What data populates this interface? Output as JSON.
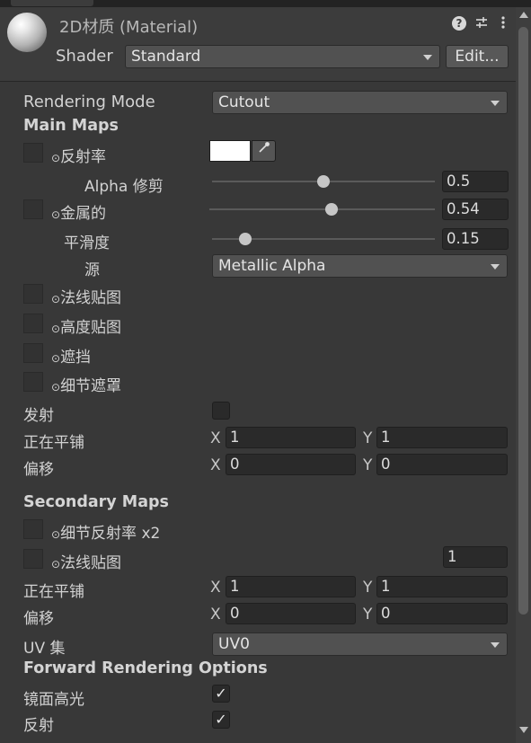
{
  "header": {
    "title": "2D材质 (Material)",
    "shader_label": "Shader",
    "shader_value": "Standard",
    "edit_button": "Edit...",
    "icons": [
      "help-icon",
      "preset-sliders-icon",
      "kebab-menu-icon"
    ]
  },
  "rendering_mode": {
    "label": "Rendering Mode",
    "value": "Cutout"
  },
  "main_maps": {
    "heading": "Main Maps",
    "albedo_label": "反射率",
    "albedo_color": "#ffffff",
    "alpha_cutoff": {
      "label": "Alpha 修剪",
      "value": "0.5",
      "fraction": 0.5
    },
    "metallic": {
      "label": "金属的",
      "value": "0.54",
      "fraction": 0.54
    },
    "smoothness": {
      "label": "平滑度",
      "value": "0.15",
      "fraction": 0.15
    },
    "source": {
      "label": "源",
      "value": "Metallic Alpha"
    },
    "normal_map_label": "法线贴图",
    "height_map_label": "高度贴图",
    "occlusion_label": "遮挡",
    "detail_mask_label": "细节遮罩",
    "emission_label": "发射",
    "emission_checked": false,
    "tiling": {
      "label": "正在平铺",
      "x_label": "X",
      "x": "1",
      "y_label": "Y",
      "y": "1"
    },
    "offset": {
      "label": "偏移",
      "x_label": "X",
      "x": "0",
      "y_label": "Y",
      "y": "0"
    }
  },
  "secondary_maps": {
    "heading": "Secondary Maps",
    "detail_albedo_label": "细节反射率 x2",
    "normal_map_label": "法线贴图",
    "normal_scale": "1",
    "tiling": {
      "label": "正在平铺",
      "x_label": "X",
      "x": "1",
      "y_label": "Y",
      "y": "1"
    },
    "offset": {
      "label": "偏移",
      "x_label": "X",
      "x": "0",
      "y_label": "Y",
      "y": "0"
    },
    "uv_set": {
      "label": "UV 集",
      "value": "UV0"
    }
  },
  "forward_rendering": {
    "heading": "Forward Rendering Options",
    "specular_label": "镜面高光",
    "specular_checked": true,
    "reflections_label": "反射",
    "reflections_checked": true
  }
}
